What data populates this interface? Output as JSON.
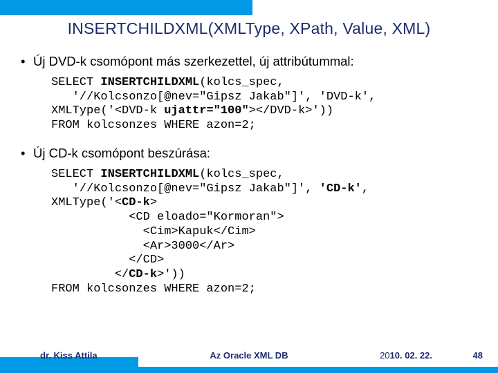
{
  "title": "INSERTCHILDXML(XMLType, XPath, Value, XML)",
  "bullet1": "Új DVD-k csomópont más szerkezettel, új attribútummal:",
  "code1_l1a": "SELECT ",
  "code1_l1b": "INSERTCHILDXML",
  "code1_l1c": "(kolcs_spec,",
  "code1_l2": "   '//Kolcsonzo[@nev=\"Gipsz Jakab\"]', 'DVD-k',",
  "code1_l3a": "XMLType('<DVD-k ",
  "code1_l3b": "ujattr=\"100\"",
  "code1_l3c": "></DVD-k>'))",
  "code1_l4": "FROM kolcsonzes WHERE azon=2;",
  "bullet2": "Új CD-k csomópont beszúrása:",
  "code2_l1a": "SELECT ",
  "code2_l1b": "INSERTCHILDXML",
  "code2_l1c": "(kolcs_spec,",
  "code2_l2a": "   '//Kolcsonzo[@nev=\"Gipsz Jakab\"]', ",
  "code2_l2b": "'CD-k'",
  "code2_l2c": ",",
  "code2_l3a": "XMLType('<",
  "code2_l3b": "CD-k",
  "code2_l3c": ">",
  "code2_l4": "           <CD eloado=\"Kormoran\">",
  "code2_l5": "             <Cim>Kapuk</Cim>",
  "code2_l6": "             <Ar>3000</Ar>",
  "code2_l7": "           </CD>",
  "code2_l8a": "         </",
  "code2_l8b": "CD-k",
  "code2_l8c": ">'))",
  "code2_l9": "FROM kolcsonzes WHERE azon=2;",
  "footer": {
    "author": "dr. Kiss Attila",
    "title": "Az Oracle XML DB",
    "date_prefix": "20",
    "date_suffix": "10. 02. 22.",
    "pagenum": "48"
  }
}
